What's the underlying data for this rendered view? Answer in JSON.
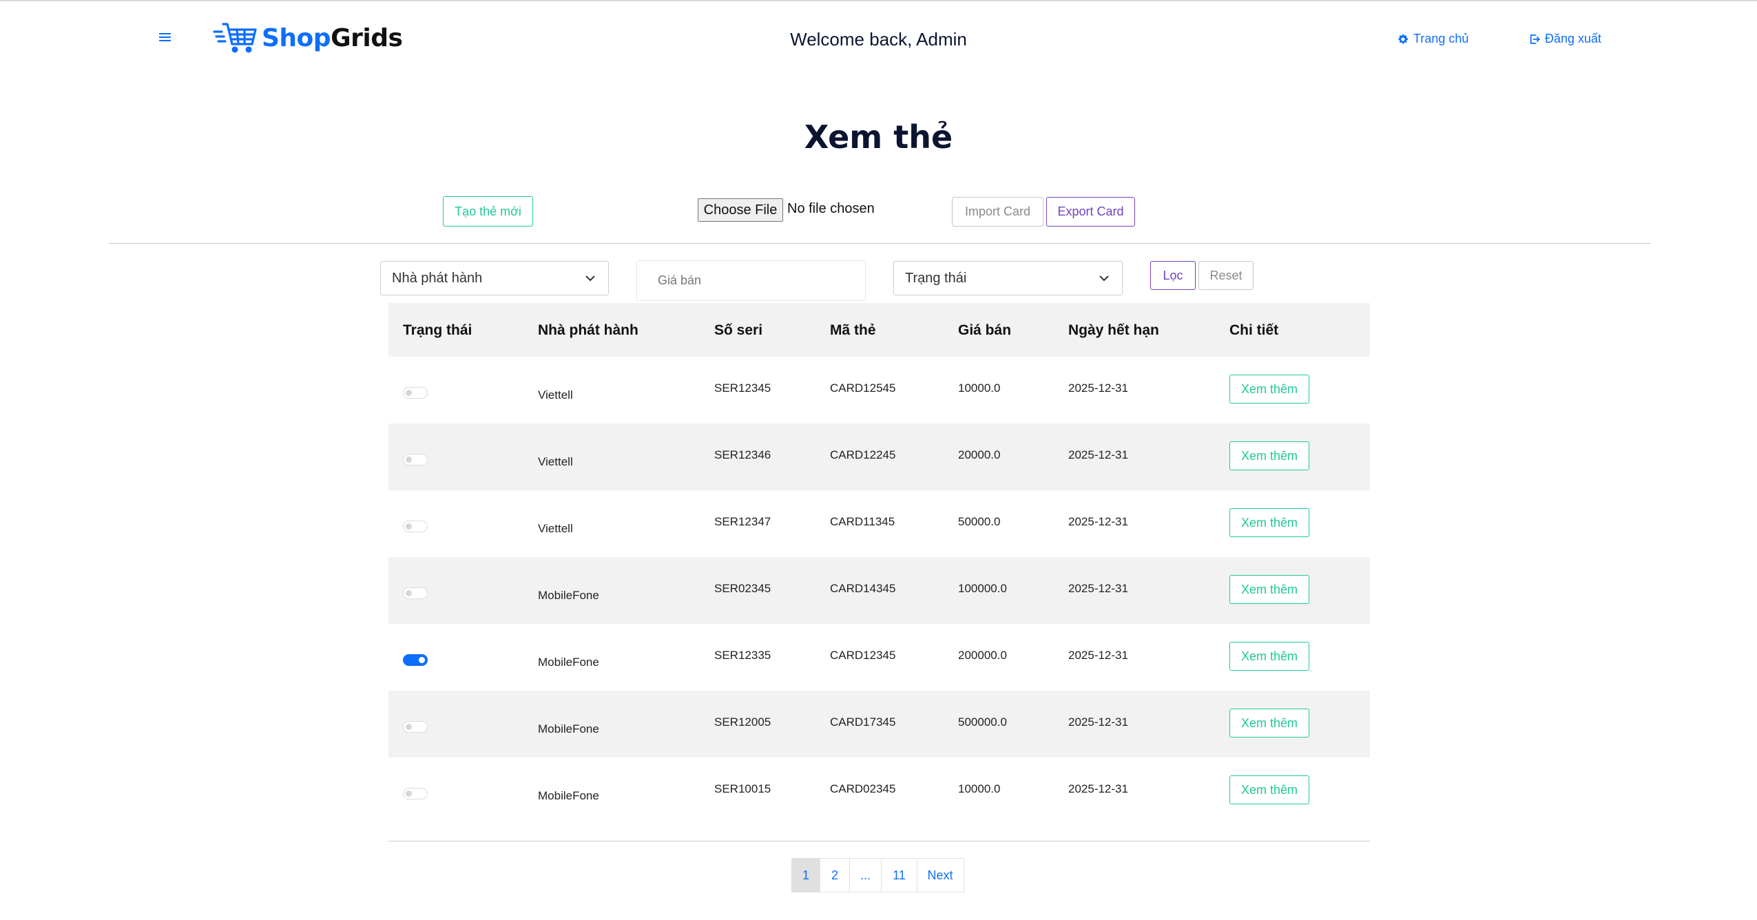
{
  "header": {
    "brand_first": "Shop",
    "brand_second": "Grids",
    "welcome": "Welcome back, Admin",
    "home_link": "Trang chủ",
    "logout_link": "Đăng xuất"
  },
  "page_title": "Xem thẻ",
  "actions": {
    "create_label": "Tạo thẻ mới",
    "file_button": "Choose File",
    "file_status": "No file chosen",
    "import_label": "Import Card",
    "export_label": "Export Card"
  },
  "filters": {
    "publisher_select": "Nhà phát hành",
    "price_placeholder": "Giá bán",
    "status_select": "Trạng thái",
    "filter_label": "Lọc",
    "reset_label": "Reset"
  },
  "table": {
    "headers": [
      "Trạng thái",
      "Nhà phát hành",
      "Số seri",
      "Mã thẻ",
      "Giá bán",
      "Ngày hết hạn",
      "Chi tiết"
    ],
    "detail_label": "Xem thêm",
    "rows": [
      {
        "active": false,
        "publisher": "Viettell",
        "serial": "SER12345",
        "code": "CARD12545",
        "price": "10000.0",
        "expiry": "2025-12-31"
      },
      {
        "active": false,
        "publisher": "Viettell",
        "serial": "SER12346",
        "code": "CARD12245",
        "price": "20000.0",
        "expiry": "2025-12-31"
      },
      {
        "active": false,
        "publisher": "Viettell",
        "serial": "SER12347",
        "code": "CARD11345",
        "price": "50000.0",
        "expiry": "2025-12-31"
      },
      {
        "active": false,
        "publisher": "MobileFone",
        "serial": "SER02345",
        "code": "CARD14345",
        "price": "100000.0",
        "expiry": "2025-12-31"
      },
      {
        "active": true,
        "publisher": "MobileFone",
        "serial": "SER12335",
        "code": "CARD12345",
        "price": "200000.0",
        "expiry": "2025-12-31"
      },
      {
        "active": false,
        "publisher": "MobileFone",
        "serial": "SER12005",
        "code": "CARD17345",
        "price": "500000.0",
        "expiry": "2025-12-31"
      },
      {
        "active": false,
        "publisher": "MobileFone",
        "serial": "SER10015",
        "code": "CARD02345",
        "price": "10000.0",
        "expiry": "2025-12-31"
      }
    ]
  },
  "pagination": {
    "pages": [
      "1",
      "2",
      "...",
      "11"
    ],
    "current": "1",
    "next_label": "Next"
  },
  "colors": {
    "primary": "#0d6efd",
    "success": "#20c997",
    "purple": "#6f42c1"
  }
}
